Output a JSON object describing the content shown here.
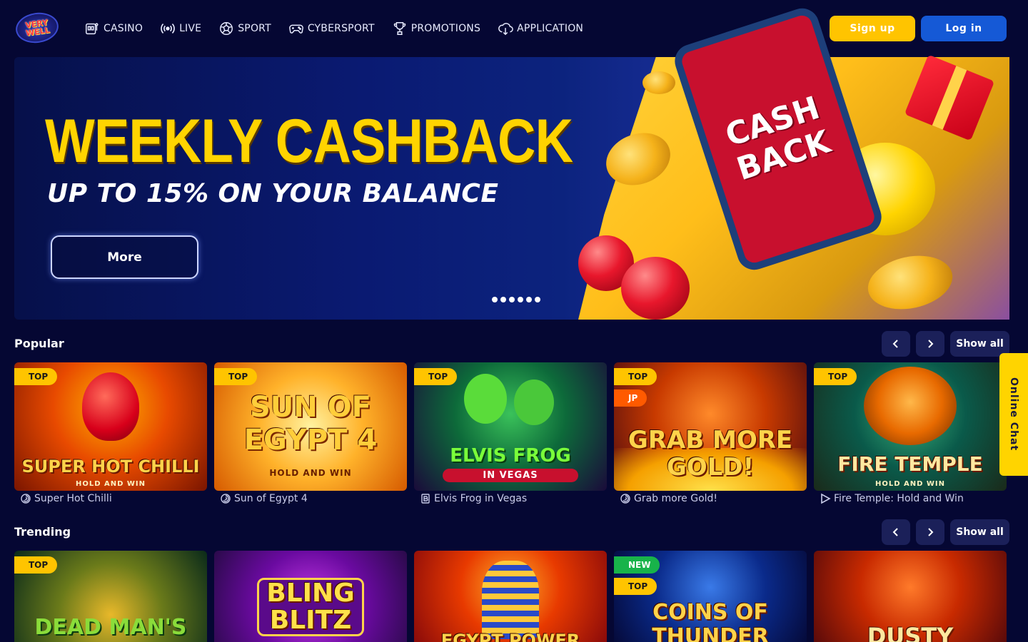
{
  "header": {
    "logo_text_1": "VERY",
    "logo_text_2": "WELL",
    "nav": [
      {
        "label": "CASINO",
        "icon": "slot-machine-icon"
      },
      {
        "label": "LIVE",
        "icon": "broadcast-icon"
      },
      {
        "label": "SPORT",
        "icon": "football-icon"
      },
      {
        "label": "CYBERSPORT",
        "icon": "gamepad-icon"
      },
      {
        "label": "PROMOTIONS",
        "icon": "trophy-icon"
      },
      {
        "label": "APPLICATION",
        "icon": "cloud-download-icon"
      }
    ],
    "signup_label": "Sign up",
    "login_label": "Log in"
  },
  "banner": {
    "title": "WEEKLY CASHBACK",
    "subtitle": "UP TO 15% ON YOUR BALANCE",
    "more_label": "More",
    "phone_text_1": "CASH",
    "phone_text_2": "BACK",
    "slides_count": 6,
    "active_slide": 1
  },
  "popular": {
    "title": "Popular",
    "show_all": "Show all",
    "games": [
      {
        "name": "Super Hot Chilli",
        "art_title": "SUPER HOT CHILLI",
        "art_sub": "HOLD AND WIN",
        "tags": [
          "TOP"
        ],
        "provider_icon": "provider-spiral-icon"
      },
      {
        "name": "Sun of Egypt 4",
        "art_title": "SUN OF EGYPT 4",
        "art_sub": "HOLD AND WIN",
        "tags": [
          "TOP"
        ],
        "provider_icon": "provider-spiral-icon"
      },
      {
        "name": "Elvis Frog in Vegas",
        "art_title": "ELVIS FROG",
        "art_sub": "IN VEGAS",
        "tags": [
          "TOP"
        ],
        "provider_icon": "provider-b-icon"
      },
      {
        "name": "Grab more Gold!",
        "art_title": "GRAB MORE GOLD!",
        "art_sub": "",
        "tags": [
          "TOP",
          "JP"
        ],
        "provider_icon": "provider-spiral-icon"
      },
      {
        "name": "Fire Temple: Hold and Win",
        "art_title": "FIRE TEMPLE",
        "art_sub": "HOLD AND WIN",
        "tags": [
          "TOP"
        ],
        "provider_icon": "provider-play-icon"
      }
    ]
  },
  "trending": {
    "title": "Trending",
    "show_all": "Show all",
    "games": [
      {
        "art_title": "DEAD MAN'S",
        "tags": [
          "TOP"
        ]
      },
      {
        "art_title": "BLING BLITZ",
        "tags": []
      },
      {
        "art_title": "EGYPT POWER",
        "tags": []
      },
      {
        "art_title": "COINS OF THUNDER",
        "tags": [
          "NEW",
          "TOP"
        ]
      },
      {
        "art_title": "DUSTY",
        "tags": []
      }
    ]
  },
  "online_chat": "Online Chat",
  "colors": {
    "background": "#050733",
    "signup": "#ffc400",
    "login": "#1559d6",
    "tag_top": "#ffc400",
    "tag_jp": "#ff5a00",
    "tag_new": "#18b34a"
  }
}
